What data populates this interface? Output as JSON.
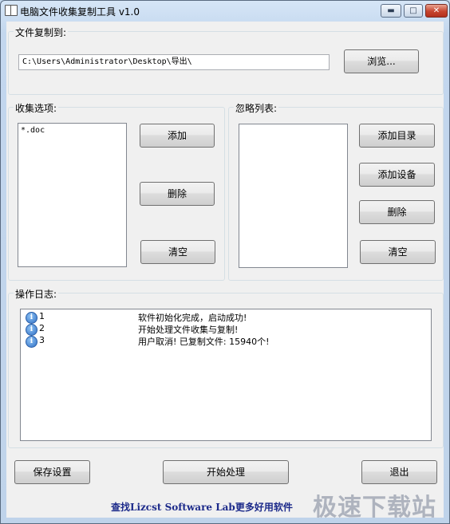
{
  "window": {
    "title": "电脑文件收集复制工具 v1.0",
    "minimize_glyph": "▬",
    "maximize_glyph": "□",
    "close_glyph": "✕"
  },
  "copy_to": {
    "label": "文件复制到:",
    "path_value": "C:\\Users\\Administrator\\Desktop\\导出\\",
    "browse_label": "浏览..."
  },
  "collect": {
    "label": "收集选项:",
    "items": [
      "*.doc"
    ],
    "add_label": "添加",
    "delete_label": "删除",
    "clear_label": "清空"
  },
  "ignore": {
    "label": "忽略列表:",
    "items": [],
    "add_dir_label": "添加目录",
    "add_device_label": "添加设备",
    "delete_label": "删除",
    "clear_label": "清空"
  },
  "log": {
    "label": "操作日志:",
    "icon": "info-icon",
    "icon_glyph": "i",
    "rows": [
      {
        "num": "1",
        "message": "软件初始化完成，启动成功!"
      },
      {
        "num": "2",
        "message": "开始处理文件收集与复制!"
      },
      {
        "num": "3",
        "message": "用户取消! 已复制文件: 15940个!"
      }
    ]
  },
  "footer": {
    "save_label": "保存设置",
    "start_label": "开始处理",
    "exit_label": "退出",
    "link_text": "查找Lizcst Software Lab更多好用软件",
    "watermark": "极速下载站"
  }
}
